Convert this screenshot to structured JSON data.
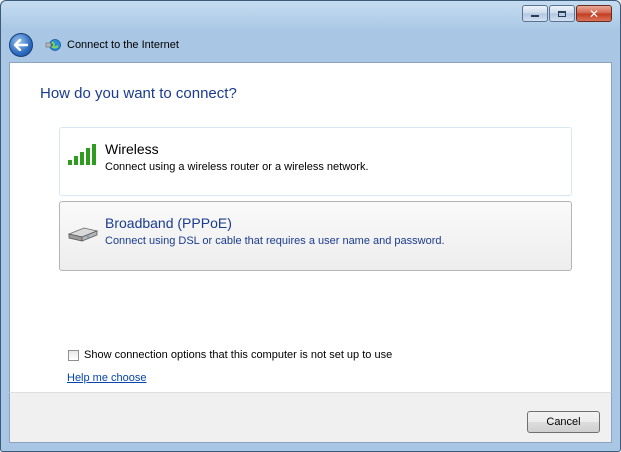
{
  "window": {
    "title": "Connect to the Internet",
    "controls": [
      "minimize-icon",
      "maximize-icon",
      "close-icon"
    ],
    "close_glyph": "✕"
  },
  "main": {
    "heading": "How do you want to connect?",
    "options": [
      {
        "icon": "wireless-signal-icon",
        "title": "Wireless",
        "description": "Connect using a wireless router or a wireless network."
      },
      {
        "icon": "modem-icon",
        "title": "Broadband (PPPoE)",
        "description": "Connect using DSL or cable that requires a user name and password."
      }
    ],
    "show_options_checkbox": {
      "label": "Show connection options that this computer is not set up to use",
      "checked": false
    },
    "help_link": "Help me choose"
  },
  "footer": {
    "cancel_label": "Cancel"
  },
  "colors": {
    "heading": "#1a3b8f",
    "link": "#0645ad",
    "close_button": "#c23a1e",
    "wireless_bars": "#2e9c1e"
  }
}
